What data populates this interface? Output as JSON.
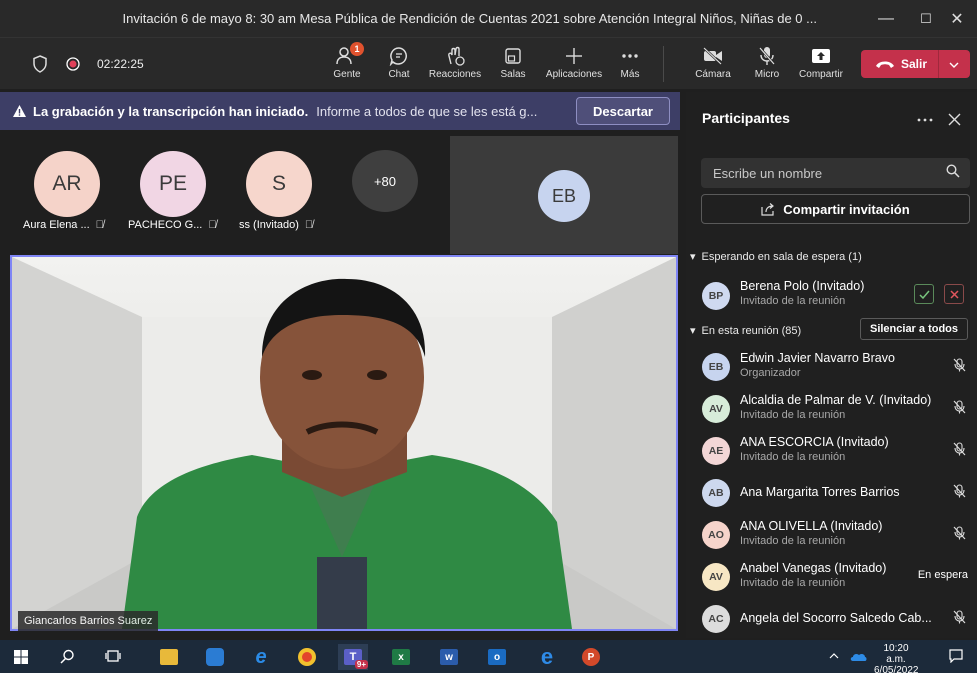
{
  "window": {
    "title": "Invitación 6 de mayo 8: 30 am Mesa Pública de Rendición de Cuentas 2021 sobre Atención Integral Niños, Niñas de 0 ...",
    "minimize": "—",
    "maximize": "☐",
    "close": "✕"
  },
  "toolbar": {
    "timer": "02:22:25",
    "buttons": [
      {
        "label": "Gente",
        "icon": "people-icon",
        "badge": "1"
      },
      {
        "label": "Chat",
        "icon": "chat-icon"
      },
      {
        "label": "Reacciones",
        "icon": "reactions-icon"
      },
      {
        "label": "Salas",
        "icon": "rooms-icon"
      },
      {
        "label": "Aplicaciones",
        "icon": "apps-plus-icon"
      },
      {
        "label": "Más",
        "icon": "more-icon"
      },
      {
        "label": "Cámara",
        "icon": "camera-off-icon"
      },
      {
        "label": "Micro",
        "icon": "mic-off-icon"
      },
      {
        "label": "Compartir",
        "icon": "share-screen-icon"
      }
    ],
    "leave_label": "Salir"
  },
  "banner": {
    "bold": "La grabación y la transcripción han iniciado.",
    "message": "Informe a todos de que se les está g...",
    "dismiss": "Descartar"
  },
  "gallery": {
    "tiles": [
      {
        "initials": "AR",
        "name": "Aura Elena ...",
        "color": "#f5d3c9"
      },
      {
        "initials": "PE",
        "name": "PACHECO G...",
        "color": "#f1d6e4"
      },
      {
        "initials": "S",
        "name": "ss (Invitado)",
        "color": "#f6d6cc"
      },
      {
        "initials": "+80",
        "name": "",
        "color": "#3f3f3f"
      }
    ],
    "featured_initials": "EB",
    "featured_color": "#c7d4ef"
  },
  "video": {
    "speaker": "Giancarlos Barrios Suarez"
  },
  "panel": {
    "title": "Participantes",
    "search_placeholder": "Escribe un nombre",
    "share_invite": "Compartir invitación",
    "waiting_header": "Esperando en sala de espera (1)",
    "waiting": [
      {
        "initials": "BP",
        "name": "Berena Polo (Invitado)",
        "role": "Invitado de la reunión",
        "color": "#cfd9f0"
      }
    ],
    "meeting_header": "En esta reunión (85)",
    "mute_all": "Silenciar a todos",
    "participants": [
      {
        "initials": "EB",
        "name": "Edwin Javier Navarro Bravo",
        "role": "Organizador",
        "color": "#c7d4ef",
        "status": ""
      },
      {
        "initials": "AV",
        "name": "Alcaldia de Palmar de V. (Invitado)",
        "role": "Invitado de la reunión",
        "color": "#d7ecd9",
        "status": ""
      },
      {
        "initials": "AE",
        "name": "ANA ESCORCIA (Invitado)",
        "role": "Invitado de la reunión",
        "color": "#f3d6d6",
        "status": ""
      },
      {
        "initials": "AB",
        "name": "Ana Margarita Torres Barrios",
        "role": "",
        "color": "#cdd8ee",
        "status": ""
      },
      {
        "initials": "AO",
        "name": "ANA OLIVELLA (Invitado)",
        "role": "Invitado de la reunión",
        "color": "#f6d4cb",
        "status": ""
      },
      {
        "initials": "AV",
        "name": "Anabel Vanegas (Invitado)",
        "role": "Invitado de la reunión",
        "color": "#f7e7c4",
        "status": "En espera"
      },
      {
        "initials": "AC",
        "name": "Angela del Socorro Salcedo Cab...",
        "role": "",
        "color": "#dcdcdc",
        "status": ""
      }
    ]
  },
  "taskbar": {
    "time": "10:20 a.m.",
    "date": "6/05/2022",
    "teams_badge": "9+"
  }
}
